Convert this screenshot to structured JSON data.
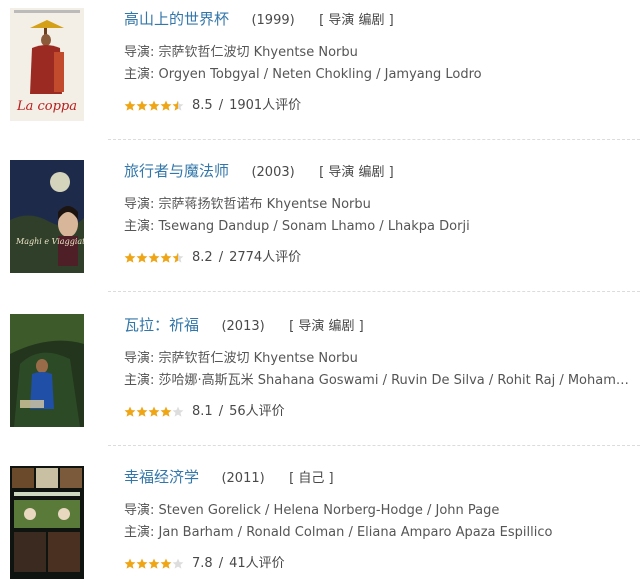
{
  "colors": {
    "title_link": "#3377aa",
    "star": "#f0a513",
    "star_empty": "#dddddd"
  },
  "movies": [
    {
      "title": "高山上的世界杯",
      "year": "(1999)",
      "roles": "[ 导演 编剧 ]",
      "director_line": "导演: 宗萨钦哲仁波切 Khyentse Norbu",
      "cast_line": "主演: Orgyen Tobgyal / Neten Chokling / Jamyang Lodro",
      "stars": 4.5,
      "score": "8.5",
      "votes": "1901人评价",
      "poster_icon": "poster-la-coppa",
      "poster_caption": "La coppa"
    },
    {
      "title": "旅行者与魔法师",
      "year": "(2003)",
      "roles": "[ 导演 编剧 ]",
      "director_line": "导演: 宗萨蒋扬钦哲诺布 Khyentse Norbu",
      "cast_line": "主演: Tsewang Dandup / Sonam Lhamo / Lhakpa Dorji",
      "stars": 4.5,
      "score": "8.2",
      "votes": "2774人评价",
      "poster_icon": "poster-maghi-e-viaggiatori",
      "poster_caption": "Maghi e Viaggiatori"
    },
    {
      "title": "瓦拉：祈福",
      "year": "(2013)",
      "roles": "[ 导演 编剧 ]",
      "director_line": "导演: 宗萨钦哲仁波切 Khyentse Norbu",
      "cast_line": "主演: 莎哈娜·高斯瓦米 Shahana Goswami / Ruvin De Silva / Rohit Raj / Mohamed ...",
      "stars": 4,
      "score": "8.1",
      "votes": "56人评价",
      "poster_icon": "poster-vara",
      "poster_caption": ""
    },
    {
      "title": "幸福经济学",
      "year": "(2011)",
      "roles": "[ 自己 ]",
      "director_line": "导演: Steven Gorelick / Helena Norberg-Hodge / John Page",
      "cast_line": "主演: Jan Barham / Ronald Colman / Eliana Amparo Apaza Espillico",
      "stars": 4,
      "score": "7.8",
      "votes": "41人评价",
      "poster_icon": "poster-economics-of-happiness",
      "poster_caption": ""
    }
  ]
}
